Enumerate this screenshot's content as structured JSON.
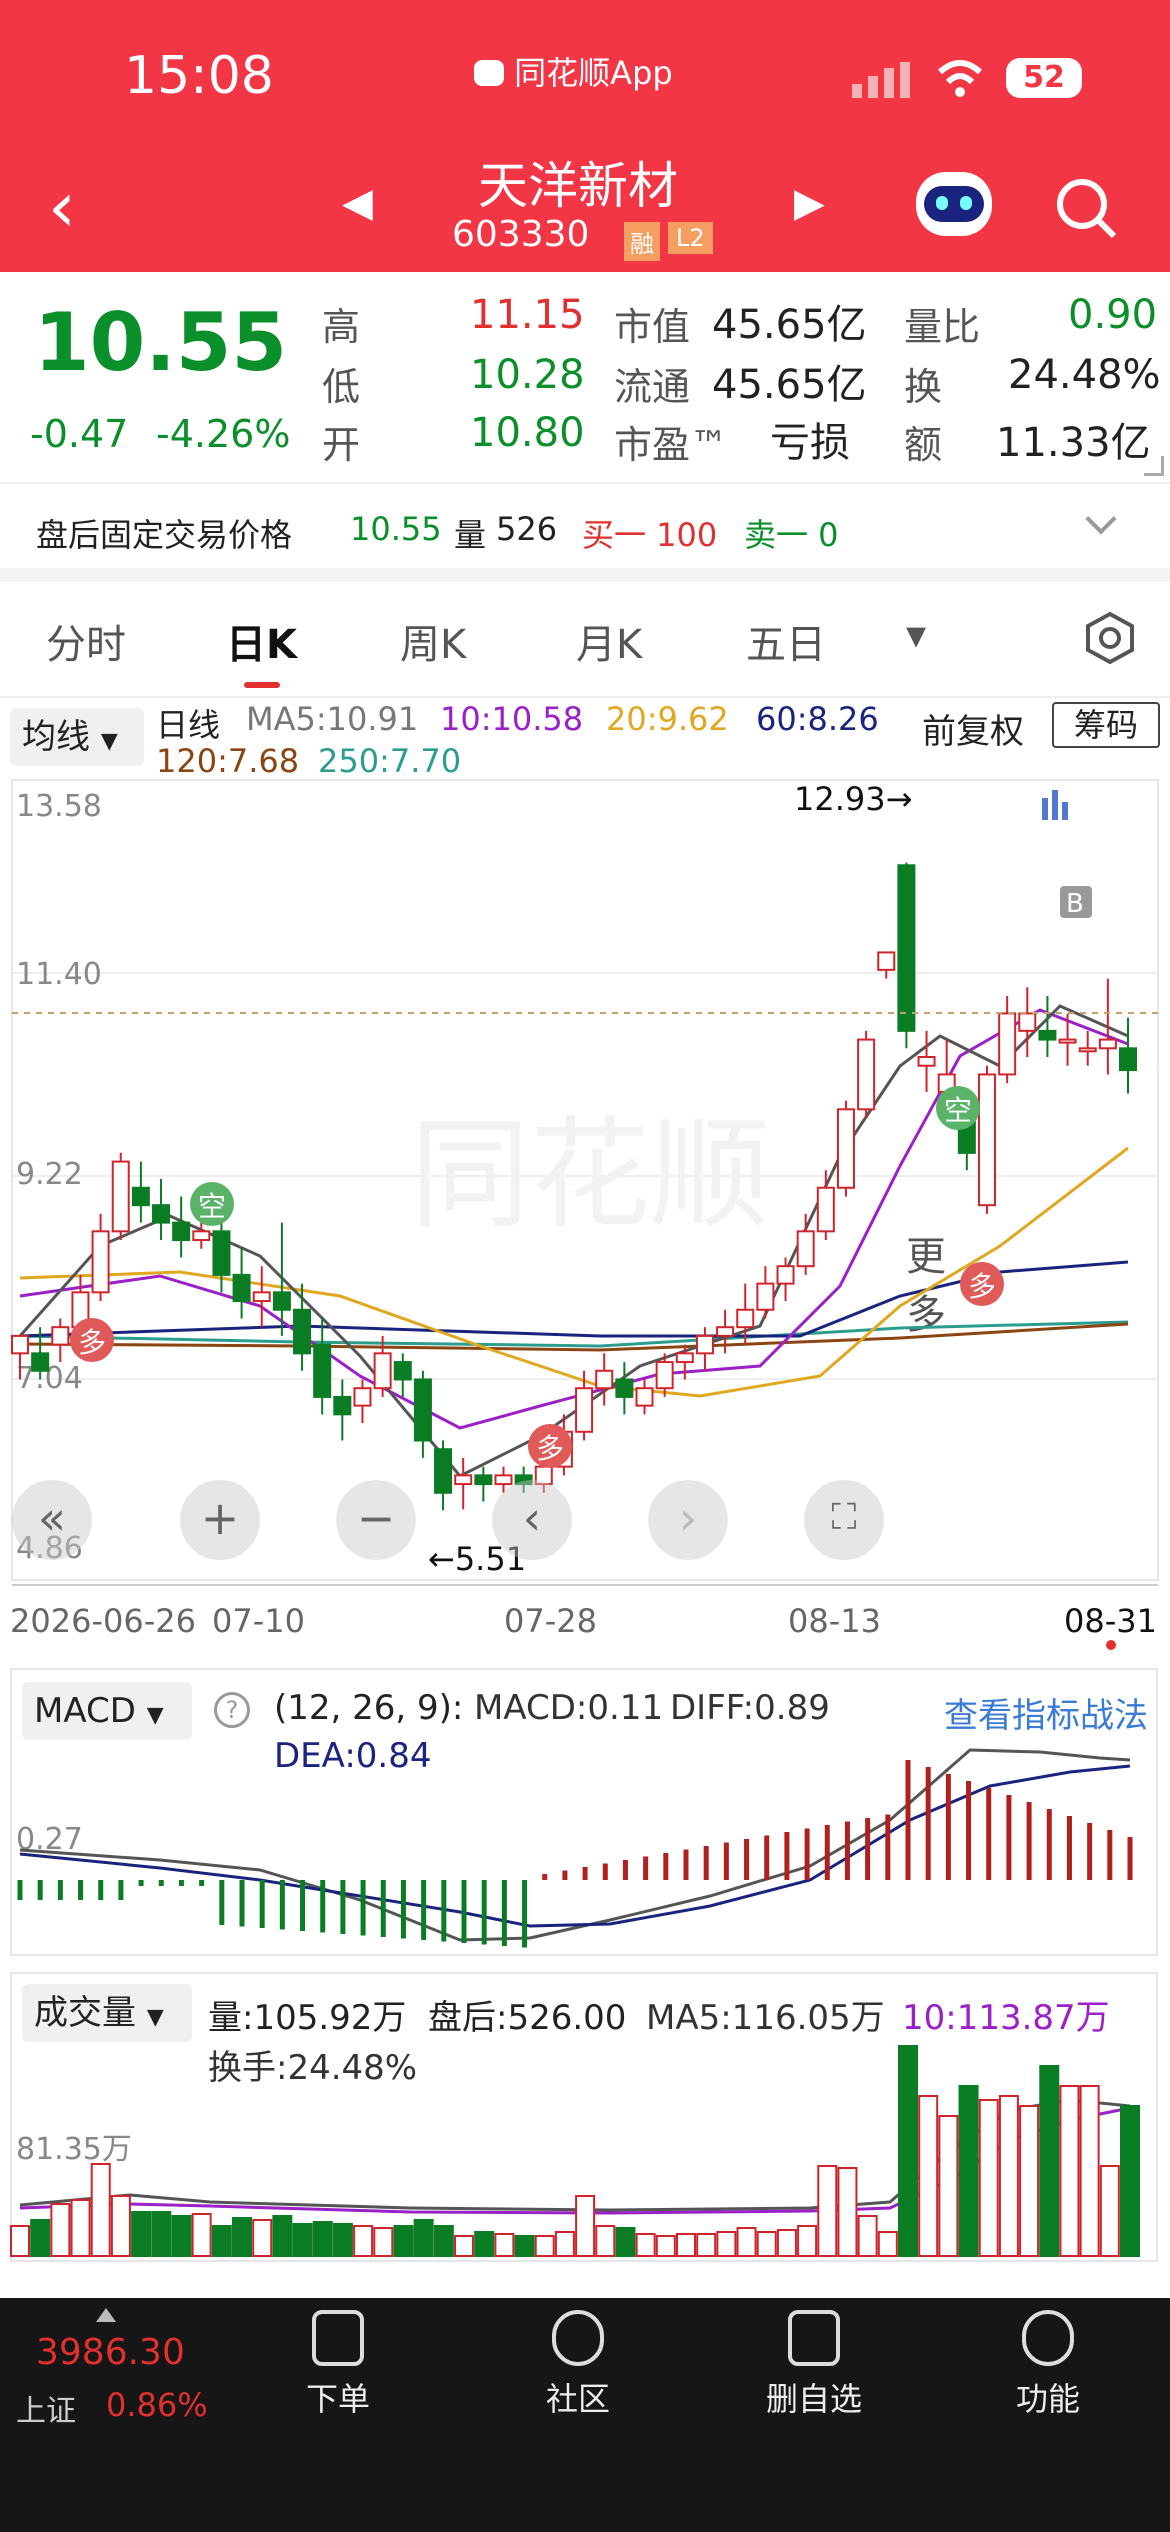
{
  "status": {
    "time": "15:08",
    "app": "同花顺App",
    "battery": "52"
  },
  "header": {
    "name": "天洋新材",
    "code": "603330",
    "tag1": "融",
    "tag2": "L2"
  },
  "quote": {
    "price": "10.55",
    "change": "-0.47",
    "pct": "-4.26%",
    "l1": "高",
    "v1": "11.15",
    "l2": "低",
    "v2": "10.28",
    "l3": "开",
    "v3": "10.80",
    "l4": "市值",
    "v4": "45.65亿",
    "l5": "流通",
    "v5": "45.65亿",
    "l6": "市盈™",
    "v6": "亏损",
    "l7": "量比",
    "v7": "0.90",
    "l8": "换",
    "v8": "24.48%",
    "l9": "额",
    "v9": "11.33亿"
  },
  "after": {
    "label": "盘后固定交易价格",
    "price": "10.55",
    "vol_label": "量",
    "vol": "526",
    "buy": "买一 100",
    "sell": "卖一 0"
  },
  "tabs": [
    "分时",
    "日K",
    "周K",
    "月K",
    "五日",
    "更多"
  ],
  "ma": {
    "selector": "均线",
    "line": "日线",
    "ma5": "MA5:10.91",
    "ma10": "10:10.58",
    "ma20": "20:9.62",
    "ma60": "60:8.26",
    "ma120": "120:7.68",
    "ma250": "250:7.70",
    "fq": "前复权",
    "chip": "筹码"
  },
  "kchart": {
    "y_labels": [
      "13.58",
      "11.40",
      "9.22",
      "7.04",
      "4.86"
    ],
    "high_label": "12.93→",
    "low_label": "←5.51",
    "x_labels": [
      "2026-06-26",
      "07-10",
      "07-28",
      "08-13",
      "08-31"
    ],
    "watermark": "同花顺",
    "badges": [
      "空",
      "多",
      "空",
      "多",
      "B"
    ]
  },
  "macd": {
    "selector": "MACD",
    "params": "(12, 26, 9):",
    "macd": "MACD:0.11",
    "diff": "DIFF:0.89",
    "dea": "DEA:0.84",
    "link": "查看指标战法",
    "axis": "0.27"
  },
  "vol": {
    "selector": "成交量",
    "vol": "量:105.92万",
    "after": "盘后:526.00",
    "ma5": "MA5:116.05万",
    "ma10": "10:113.87万",
    "turn": "换手:24.48%",
    "axis": "81.35万"
  },
  "bottom": {
    "index": "3986.30",
    "index_name": "上证",
    "index_pct": "0.86%",
    "items": [
      "下单",
      "社区",
      "删自选",
      "功能"
    ]
  },
  "chart_data": {
    "type": "candlestick",
    "ylim": [
      4.86,
      13.58
    ],
    "candles": [
      [
        7.3,
        7.5,
        7.0,
        7.3
      ],
      [
        7.3,
        7.1,
        7.0,
        7.6
      ],
      [
        7.4,
        7.6,
        7.2,
        7.7
      ],
      [
        7.6,
        8.0,
        7.5,
        8.2
      ],
      [
        8.0,
        8.7,
        7.9,
        8.9
      ],
      [
        8.7,
        9.5,
        8.6,
        9.6
      ],
      [
        9.2,
        9.0,
        8.8,
        9.5
      ],
      [
        9.0,
        8.8,
        8.6,
        9.3
      ],
      [
        8.8,
        8.6,
        8.4,
        9.1
      ],
      [
        8.6,
        8.7,
        8.5,
        8.9
      ],
      [
        8.7,
        8.2,
        8.0,
        9.0
      ],
      [
        8.2,
        7.9,
        7.7,
        8.5
      ],
      [
        7.9,
        8.0,
        7.6,
        8.3
      ],
      [
        8.0,
        7.8,
        7.5,
        8.8
      ],
      [
        7.8,
        7.3,
        7.1,
        8.1
      ],
      [
        7.4,
        6.8,
        6.6,
        7.7
      ],
      [
        6.8,
        6.6,
        6.3,
        7.0
      ],
      [
        6.7,
        6.9,
        6.5,
        7.0
      ],
      [
        6.9,
        7.3,
        6.8,
        7.5
      ],
      [
        7.2,
        7.0,
        6.8,
        7.3
      ],
      [
        7.0,
        6.3,
        6.1,
        7.1
      ],
      [
        6.2,
        5.7,
        5.5,
        6.3
      ],
      [
        5.8,
        5.9,
        5.51,
        6.1
      ],
      [
        5.9,
        5.8,
        5.6,
        6.0
      ],
      [
        5.8,
        5.9,
        5.7,
        6.0
      ],
      [
        5.9,
        5.8,
        5.7,
        6.0
      ],
      [
        5.8,
        6.0,
        5.7,
        6.2
      ],
      [
        6.0,
        6.4,
        5.9,
        6.6
      ],
      [
        6.4,
        6.9,
        6.3,
        7.1
      ],
      [
        6.9,
        7.1,
        6.7,
        7.3
      ],
      [
        7.0,
        6.8,
        6.6,
        7.2
      ],
      [
        6.7,
        6.9,
        6.6,
        7.0
      ],
      [
        6.9,
        7.2,
        6.8,
        7.3
      ],
      [
        7.2,
        7.3,
        7.0,
        7.4
      ],
      [
        7.3,
        7.5,
        7.1,
        7.6
      ],
      [
        7.5,
        7.6,
        7.3,
        7.8
      ],
      [
        7.6,
        7.8,
        7.4,
        8.1
      ],
      [
        7.8,
        8.1,
        7.7,
        8.3
      ],
      [
        8.1,
        8.3,
        7.9,
        8.4
      ],
      [
        8.3,
        8.7,
        8.2,
        8.9
      ],
      [
        8.7,
        9.2,
        8.6,
        9.4
      ],
      [
        9.2,
        10.1,
        9.1,
        10.2
      ],
      [
        10.1,
        10.9,
        10.0,
        11.0
      ],
      [
        11.7,
        11.9,
        11.6,
        11.9
      ],
      [
        12.9,
        11.0,
        10.8,
        12.93
      ],
      [
        10.6,
        10.7,
        10.3,
        11.0
      ],
      [
        10.3,
        10.5,
        10.1,
        10.9
      ],
      [
        10.0,
        9.6,
        9.4,
        10.3
      ],
      [
        9.0,
        10.5,
        8.9,
        10.6
      ],
      [
        10.5,
        11.2,
        10.4,
        11.4
      ],
      [
        11.0,
        11.2,
        10.7,
        11.5
      ],
      [
        11.0,
        10.9,
        10.7,
        11.4
      ],
      [
        10.9,
        10.9,
        10.6,
        11.2
      ],
      [
        10.8,
        10.8,
        10.6,
        11.0
      ],
      [
        10.8,
        10.9,
        10.5,
        11.6
      ],
      [
        10.8,
        10.55,
        10.28,
        11.15
      ]
    ]
  }
}
